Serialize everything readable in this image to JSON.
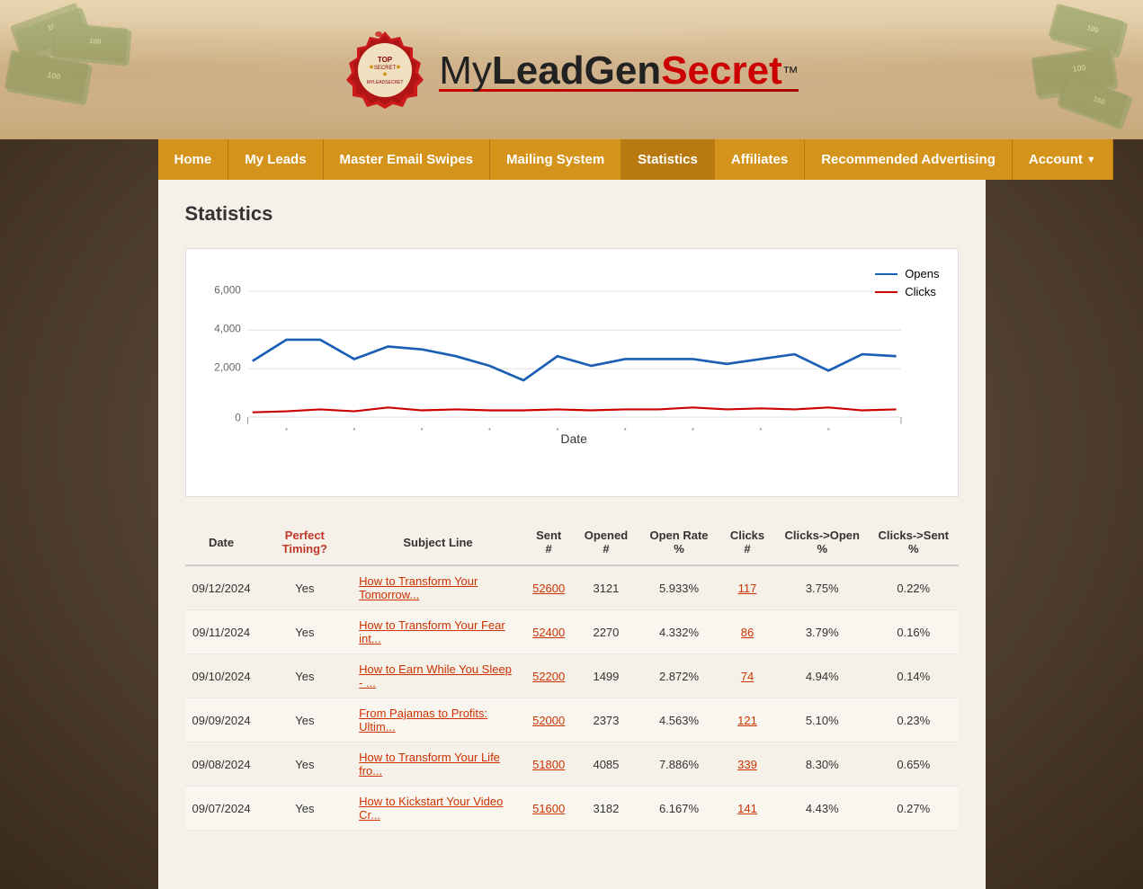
{
  "header": {
    "logo_my": "My",
    "logo_leadgen": "LeadGen",
    "logo_secret": "Secret",
    "logo_tm": "™"
  },
  "nav": {
    "items": [
      {
        "id": "home",
        "label": "Home",
        "active": false
      },
      {
        "id": "my-leads",
        "label": "My Leads",
        "active": false
      },
      {
        "id": "master-email-swipes",
        "label": "Master Email Swipes",
        "active": false
      },
      {
        "id": "mailing-system",
        "label": "Mailing System",
        "active": false
      },
      {
        "id": "statistics",
        "label": "Statistics",
        "active": true
      },
      {
        "id": "affiliates",
        "label": "Affiliates",
        "active": false
      },
      {
        "id": "recommended-advertising",
        "label": "Recommended Advertising",
        "active": false
      },
      {
        "id": "account",
        "label": "Account",
        "active": false,
        "has_dropdown": true
      }
    ]
  },
  "page": {
    "title": "Statistics"
  },
  "chart": {
    "y_labels": [
      "6,000",
      "4,000",
      "2,000",
      "0"
    ],
    "x_label": "Date",
    "legend": {
      "opens_label": "Opens",
      "clicks_label": "Clicks"
    }
  },
  "table": {
    "columns": [
      {
        "id": "date",
        "label": "Date"
      },
      {
        "id": "perfect_timing",
        "label": "Perfect Timing?",
        "colored": true
      },
      {
        "id": "subject_line",
        "label": "Subject Line"
      },
      {
        "id": "sent",
        "label": "Sent #"
      },
      {
        "id": "opened",
        "label": "Opened #"
      },
      {
        "id": "open_rate",
        "label": "Open Rate %"
      },
      {
        "id": "clicks",
        "label": "Clicks #"
      },
      {
        "id": "clicks_open",
        "label": "Clicks->Open %"
      },
      {
        "id": "clicks_sent",
        "label": "Clicks->Sent %"
      }
    ],
    "rows": [
      {
        "date": "09/12/2024",
        "perfect_timing": "Yes",
        "subject": "How to Transform Your Tomorrow...",
        "sent": "52600",
        "opened": "3121",
        "open_rate": "5.933%",
        "clicks": "117",
        "clicks_open": "3.75%",
        "clicks_sent": "0.22%"
      },
      {
        "date": "09/11/2024",
        "perfect_timing": "Yes",
        "subject": "How to Transform Your Fear int...",
        "sent": "52400",
        "opened": "2270",
        "open_rate": "4.332%",
        "clicks": "86",
        "clicks_open": "3.79%",
        "clicks_sent": "0.16%"
      },
      {
        "date": "09/10/2024",
        "perfect_timing": "Yes",
        "subject": "How to Earn While You Sleep - ...",
        "sent": "52200",
        "opened": "1499",
        "open_rate": "2.872%",
        "clicks": "74",
        "clicks_open": "4.94%",
        "clicks_sent": "0.14%"
      },
      {
        "date": "09/09/2024",
        "perfect_timing": "Yes",
        "subject": "From Pajamas to Profits: Ultim...",
        "sent": "52000",
        "opened": "2373",
        "open_rate": "4.563%",
        "clicks": "121",
        "clicks_open": "5.10%",
        "clicks_sent": "0.23%"
      },
      {
        "date": "09/08/2024",
        "perfect_timing": "Yes",
        "subject": "How to Transform Your Life fro...",
        "sent": "51800",
        "opened": "4085",
        "open_rate": "7.886%",
        "clicks": "339",
        "clicks_open": "8.30%",
        "clicks_sent": "0.65%"
      },
      {
        "date": "09/07/2024",
        "perfect_timing": "Yes",
        "subject": "How to Kickstart Your Video Cr...",
        "sent": "51600",
        "opened": "3182",
        "open_rate": "6.167%",
        "clicks": "141",
        "clicks_open": "4.43%",
        "clicks_sent": "0.27%"
      }
    ]
  }
}
